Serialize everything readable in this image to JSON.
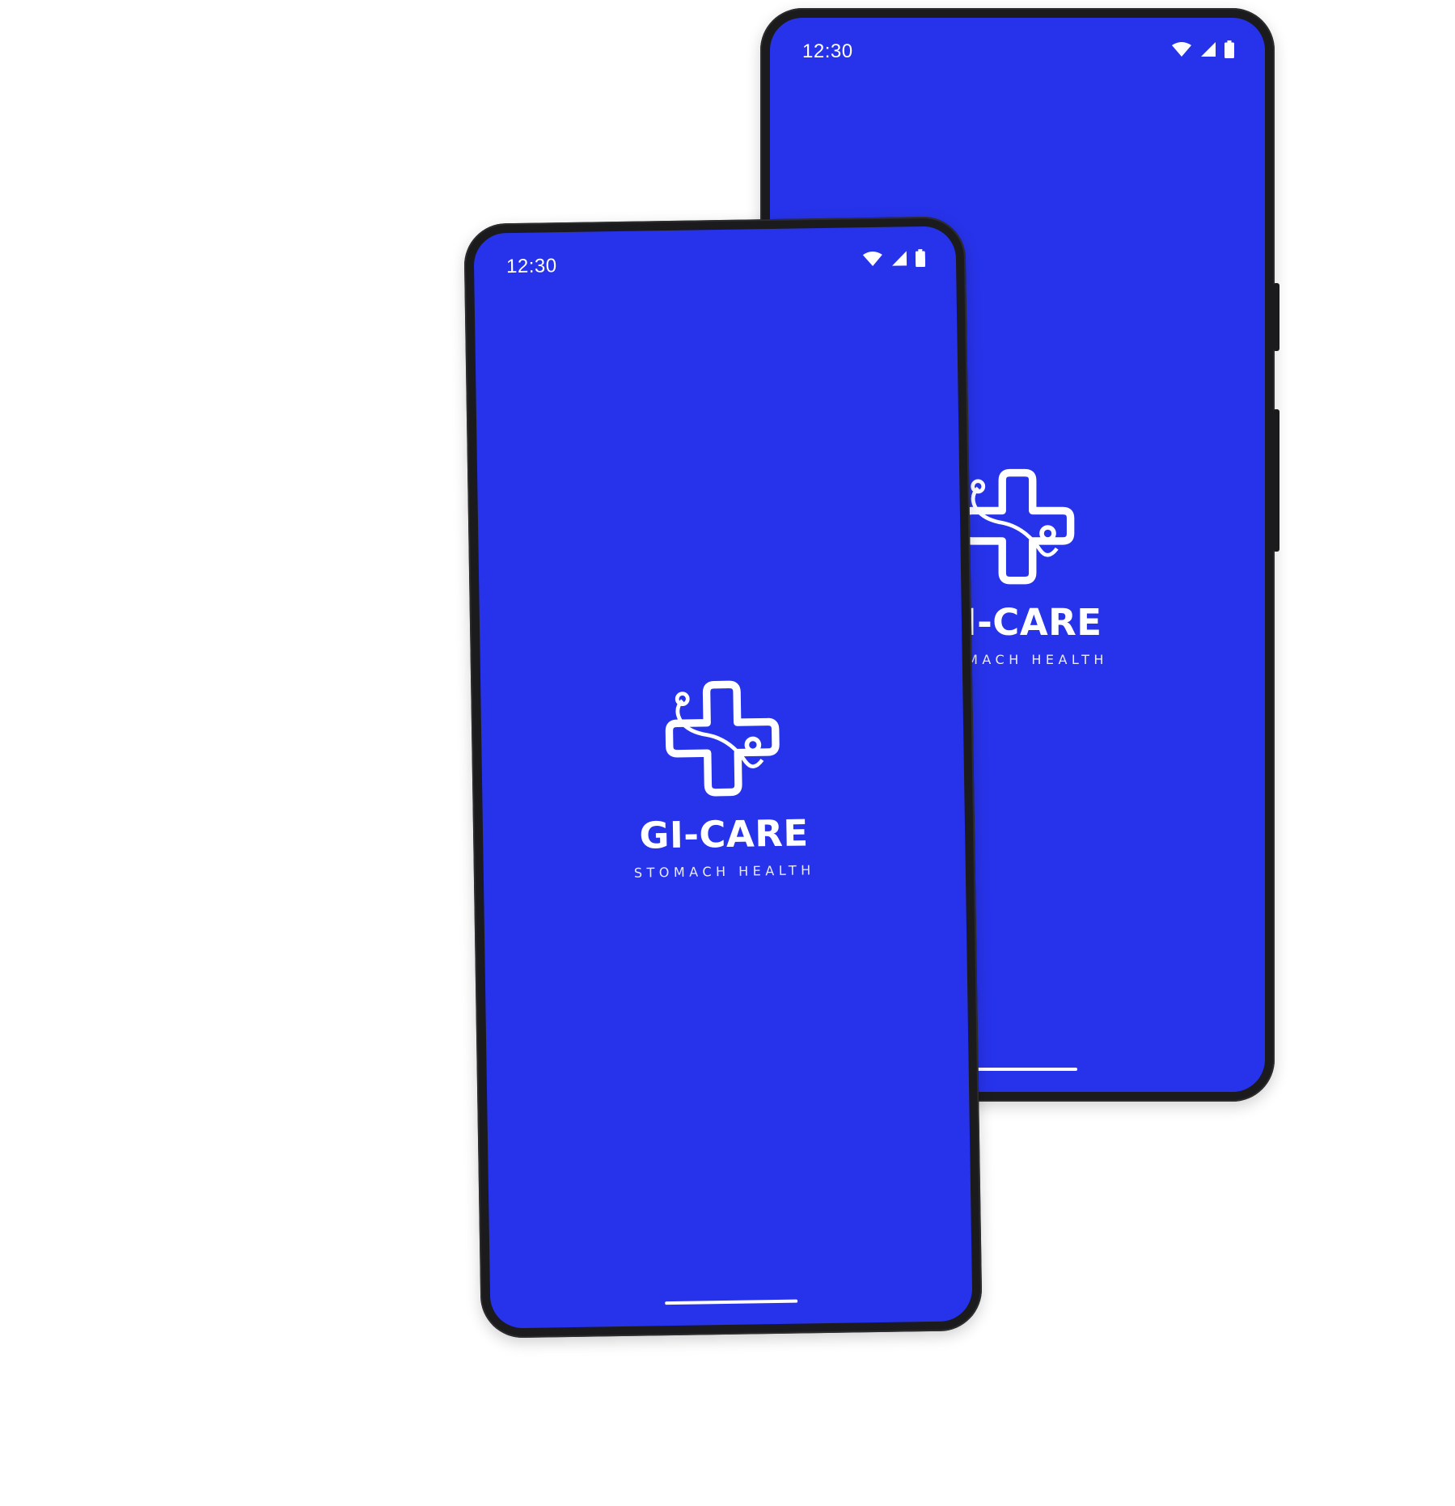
{
  "theme": {
    "screen_color": "#2733ea",
    "frame_color": "#1b1b1d"
  },
  "phones": [
    {
      "status_time": "12:30",
      "icons": [
        "wifi-icon",
        "cellular-signal-icon",
        "battery-icon"
      ],
      "brand_title": "GI-CARE",
      "brand_tagline": "STOMACH HEALTH"
    },
    {
      "status_time": "12:30",
      "icons": [
        "wifi-icon",
        "cellular-signal-icon",
        "battery-icon"
      ],
      "brand_title": "GI-CARE",
      "brand_tagline": "STOMACH HEALTH"
    }
  ]
}
